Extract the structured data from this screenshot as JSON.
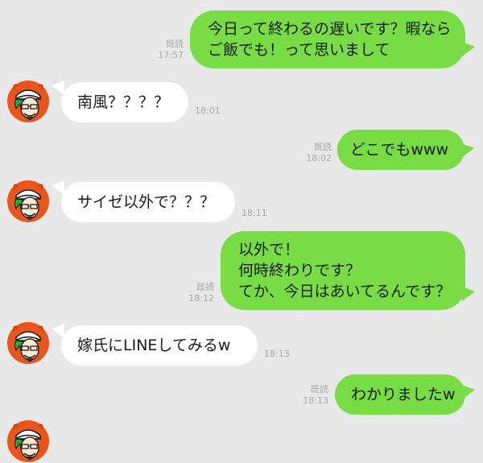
{
  "read_label": "既読",
  "messages": [
    {
      "text": "今日って終わるの遅いです？暇なら\nご飯でも！って思いまして",
      "time": "17:57"
    },
    {
      "text": "南風？？？？",
      "time": "18:01"
    },
    {
      "text": "どこでもwww",
      "time": "18:02"
    },
    {
      "text": "サイゼ以外で？？？",
      "time": "18:11"
    },
    {
      "text": "以外で！\n何時終わりです？\nてか、今日はあいてるんです？",
      "time": "18:12"
    },
    {
      "text": "嫁氏にLINEしてみるw",
      "time": "18:13"
    },
    {
      "text": "わかりましたw",
      "time": "18:13"
    }
  ],
  "colors": {
    "background": "#e8e8e8",
    "outgoing_bubble": "#78dc44",
    "incoming_bubble": "#ffffff",
    "meta_text": "#a8a8a8"
  },
  "icons": {
    "avatar": "user-avatar-icon"
  }
}
